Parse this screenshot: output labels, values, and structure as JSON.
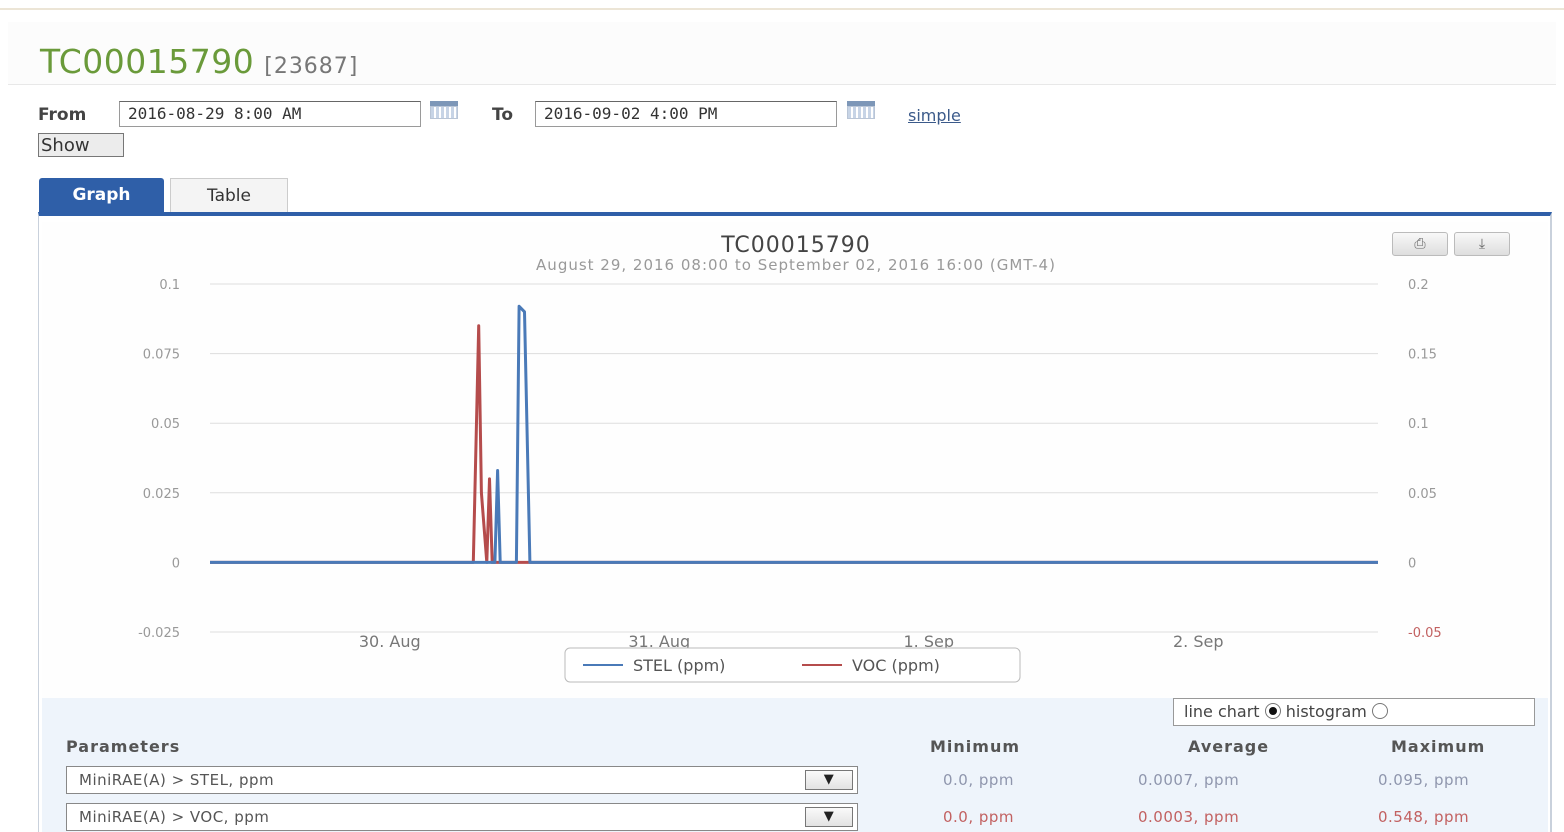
{
  "header": {
    "title": "TC00015790",
    "id": "[23687]"
  },
  "range": {
    "from_label": "From",
    "from_value": "2016-08-29 8:00 AM",
    "to_label": "To",
    "to_value": "2016-09-02 4:00 PM",
    "simple_link": "simple",
    "show_button": "Show"
  },
  "tabs": [
    {
      "label": "Graph",
      "active": true
    },
    {
      "label": "Table",
      "active": false
    }
  ],
  "chart_data": {
    "type": "line",
    "title": "TC00015790",
    "subtitle": "August 29, 2016 08:00 to September 02, 2016 16:00 (GMT-4)",
    "x_ticks": [
      "30. Aug",
      "31. Aug",
      "1. Sep",
      "2. Sep"
    ],
    "x_tick_values": [
      30,
      31,
      32,
      33
    ],
    "xlim": [
      29.333,
      33.667
    ],
    "y_left": {
      "ticks": [
        "0.1",
        "0.075",
        "0.05",
        "0.025",
        "0",
        "-0.025"
      ],
      "ylim": [
        -0.025,
        0.1
      ]
    },
    "y_right": {
      "ticks": [
        "0.2",
        "0.15",
        "0.1",
        "0.05",
        "0",
        "-0.05"
      ],
      "ylim": [
        -0.05,
        0.2
      ]
    },
    "grid": true,
    "legend_position": "bottom-center",
    "series": [
      {
        "name": "STEL (ppm)",
        "color": "#4a7ab8",
        "axis": "left",
        "x": [
          29.333,
          30.36,
          30.39,
          30.4,
          30.41,
          30.44,
          30.47,
          30.48,
          30.5,
          30.52,
          30.55,
          33.667
        ],
        "y": [
          0,
          0,
          0,
          0.033,
          0,
          0,
          0,
          0.092,
          0.09,
          0,
          0,
          0
        ]
      },
      {
        "name": "VOC (ppm)",
        "color": "#b54c4c",
        "axis": "right",
        "x": [
          29.333,
          30.31,
          30.33,
          30.34,
          30.36,
          30.37,
          30.38,
          30.4,
          33.667
        ],
        "y": [
          0,
          0,
          0.17,
          0.05,
          0,
          0.06,
          0,
          0,
          0
        ]
      }
    ]
  },
  "chart_options": {
    "line_label": "line chart",
    "histogram_label": "histogram",
    "selected": "line chart"
  },
  "table": {
    "headers": {
      "parameters": "Parameters",
      "minimum": "Minimum",
      "average": "Average",
      "maximum": "Maximum"
    },
    "rows": [
      {
        "parameter": "MiniRAE(A) > STEL, ppm",
        "min": "0.0, ppm",
        "avg": "0.0007, ppm",
        "max": "0.095, ppm",
        "color": "#8f96ad"
      },
      {
        "parameter": "MiniRAE(A) > VOC, ppm",
        "min": "0.0, ppm",
        "avg": "0.0003, ppm",
        "max": "0.548, ppm",
        "color": "#c26161"
      }
    ]
  }
}
